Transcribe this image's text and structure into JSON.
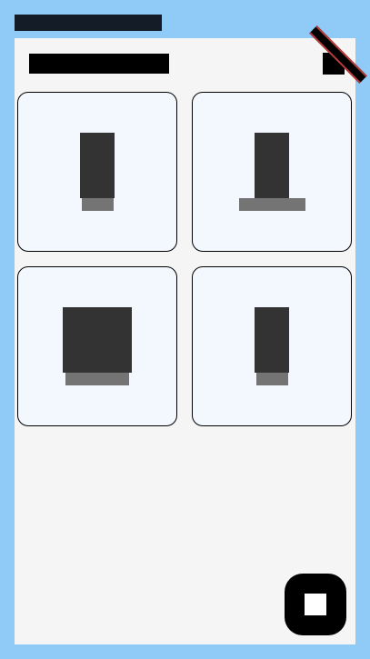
{
  "status_bar": {
    "text": ""
  },
  "header": {
    "title": "",
    "action_icon": "menu-icon"
  },
  "cards": [
    {
      "icon": "product-icon-narrow"
    },
    {
      "icon": "product-icon-wide-base"
    },
    {
      "icon": "product-icon-wide"
    },
    {
      "icon": "product-icon-narrow"
    }
  ],
  "fab": {
    "icon": "stop-icon"
  },
  "colors": {
    "frame_background": "#90cbf8",
    "screen_background": "#f5f5f5",
    "card_background": "#f3f8ff",
    "icon_dark": "#333333",
    "icon_gray": "#747474",
    "accent_red": "#b73a3a"
  }
}
